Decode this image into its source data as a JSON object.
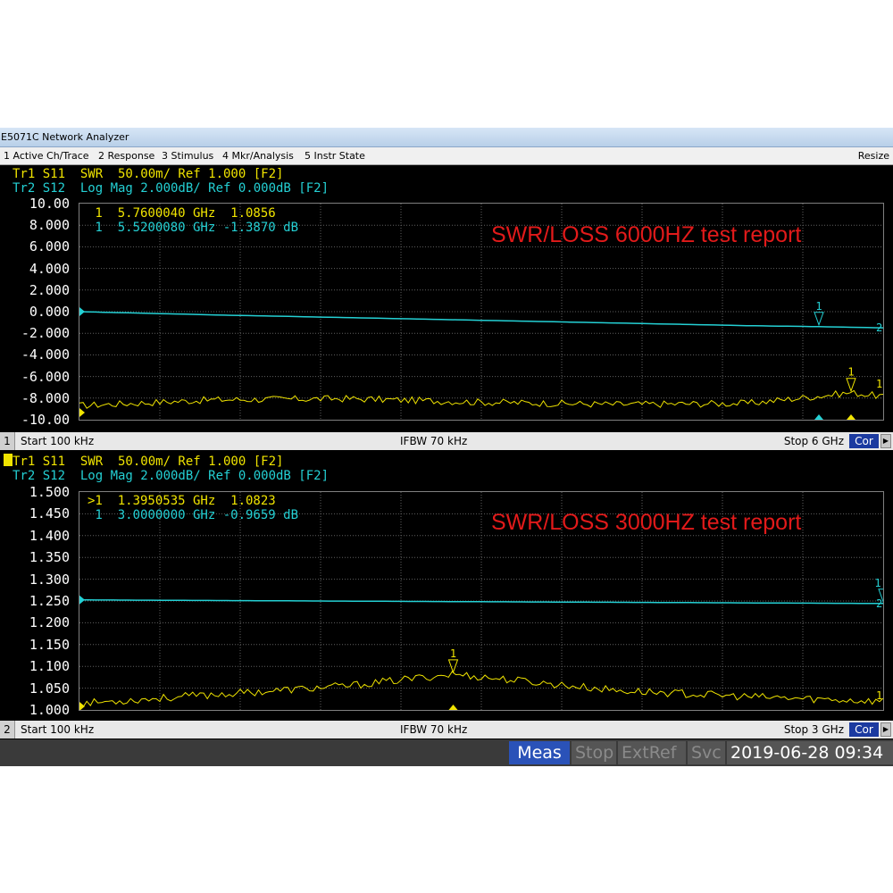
{
  "window": {
    "title": "E5071C Network Analyzer"
  },
  "menu": {
    "items": [
      "1 Active Ch/Trace",
      "2 Response",
      "3 Stimulus",
      "4 Mkr/Analysis",
      "5 Instr State"
    ],
    "resize": "Resize"
  },
  "channels": [
    {
      "number": "1",
      "tr1_header": "Tr1 S11  SWR  50.00m/ Ref 1.000 [F2]",
      "tr2_header": "Tr2 S12  Log Mag 2.000dB/ Ref 0.000dB [F2]",
      "y_ticks": [
        "10.00",
        "8.000",
        "6.000",
        "4.000",
        "2.000",
        "0.000",
        "-2.000",
        "-4.000",
        "-6.000",
        "-8.000",
        "-10.00"
      ],
      "marker_tr1": " 1  5.7600040 GHz  1.0856",
      "marker_tr2": " 1  5.5200080 GHz -1.3870 dB",
      "report": "SWR/LOSS 6000HZ test report",
      "start": "Start 100 kHz",
      "ifbw": "IFBW 70 kHz",
      "stop": "Stop 6 GHz",
      "cor": "Cor",
      "marker_label": "1",
      "trace_end_labels": [
        "1",
        "2"
      ]
    },
    {
      "number": "2",
      "tr1_header": "Tr1 S11  SWR  50.00m/ Ref 1.000 [F2]",
      "tr2_header": "Tr2 S12  Log Mag 2.000dB/ Ref 0.000dB [F2]",
      "y_ticks": [
        "1.500",
        "1.450",
        "1.400",
        "1.350",
        "1.300",
        "1.250",
        "1.200",
        "1.150",
        "1.100",
        "1.050",
        "1.000"
      ],
      "marker_tr1": ">1  1.3950535 GHz  1.0823",
      "marker_tr2": " 1  3.0000000 GHz -0.9659 dB",
      "report": "SWR/LOSS 3000HZ test report",
      "start": "Start 100 kHz",
      "ifbw": "IFBW 70 kHz",
      "stop": "Stop 3 GHz",
      "cor": "Cor",
      "marker_label": "1",
      "trace_end_labels": [
        "1",
        "2"
      ]
    }
  ],
  "statusbar": {
    "meas": "Meas",
    "stop": "Stop",
    "extref": "ExtRef",
    "svc": "Svc",
    "datetime": "2019-06-28 09:34"
  },
  "colors": {
    "trace1": "#f0e400",
    "trace2": "#24d0d4",
    "report": "#e21a1a",
    "grid": "#606060"
  },
  "chart_data": [
    {
      "type": "line",
      "x_unit": "GHz",
      "xlim": [
        0.0001,
        6
      ],
      "series": [
        {
          "name": "Tr1 S11 SWR",
          "scale": "SWR 50.00m/div, Ref 1.000",
          "x": [
            0.0001,
            1,
            2,
            3,
            4,
            5,
            5.76,
            6
          ],
          "values": [
            1.03,
            1.055,
            1.06,
            1.045,
            1.035,
            1.04,
            1.0856,
            1.07
          ]
        },
        {
          "name": "Tr2 S12 Log Mag",
          "unit": "dB",
          "x": [
            0.0001,
            1,
            2,
            3,
            4,
            5,
            5.52,
            6
          ],
          "values": [
            0.0,
            -0.3,
            -0.55,
            -0.8,
            -1.05,
            -1.3,
            -1.387,
            -1.5
          ]
        }
      ],
      "marker_tr1": {
        "x": 5.760004,
        "value": 1.0856
      },
      "marker_tr2": {
        "x": 5.520008,
        "value": -1.387
      },
      "ylim": [
        -10,
        10
      ]
    },
    {
      "type": "line",
      "x_unit": "GHz",
      "xlim": [
        0.0001,
        3
      ],
      "series": [
        {
          "name": "Tr1 S11 SWR",
          "x": [
            0.0001,
            0.5,
            1,
            1.395,
            2,
            2.5,
            3
          ],
          "values": [
            1.015,
            1.035,
            1.055,
            1.0823,
            1.045,
            1.03,
            1.02
          ]
        },
        {
          "name": "Tr2 S12 Log Mag",
          "unit": "dB",
          "x": [
            0.0001,
            1,
            2,
            3
          ],
          "values": [
            0.0,
            -0.33,
            -0.65,
            -0.9659
          ]
        }
      ],
      "marker_tr1": {
        "x": 1.3950535,
        "value": 1.0823
      },
      "marker_tr2": {
        "x": 3.0,
        "value": -0.9659
      },
      "ylim": [
        1.0,
        1.5
      ]
    }
  ]
}
